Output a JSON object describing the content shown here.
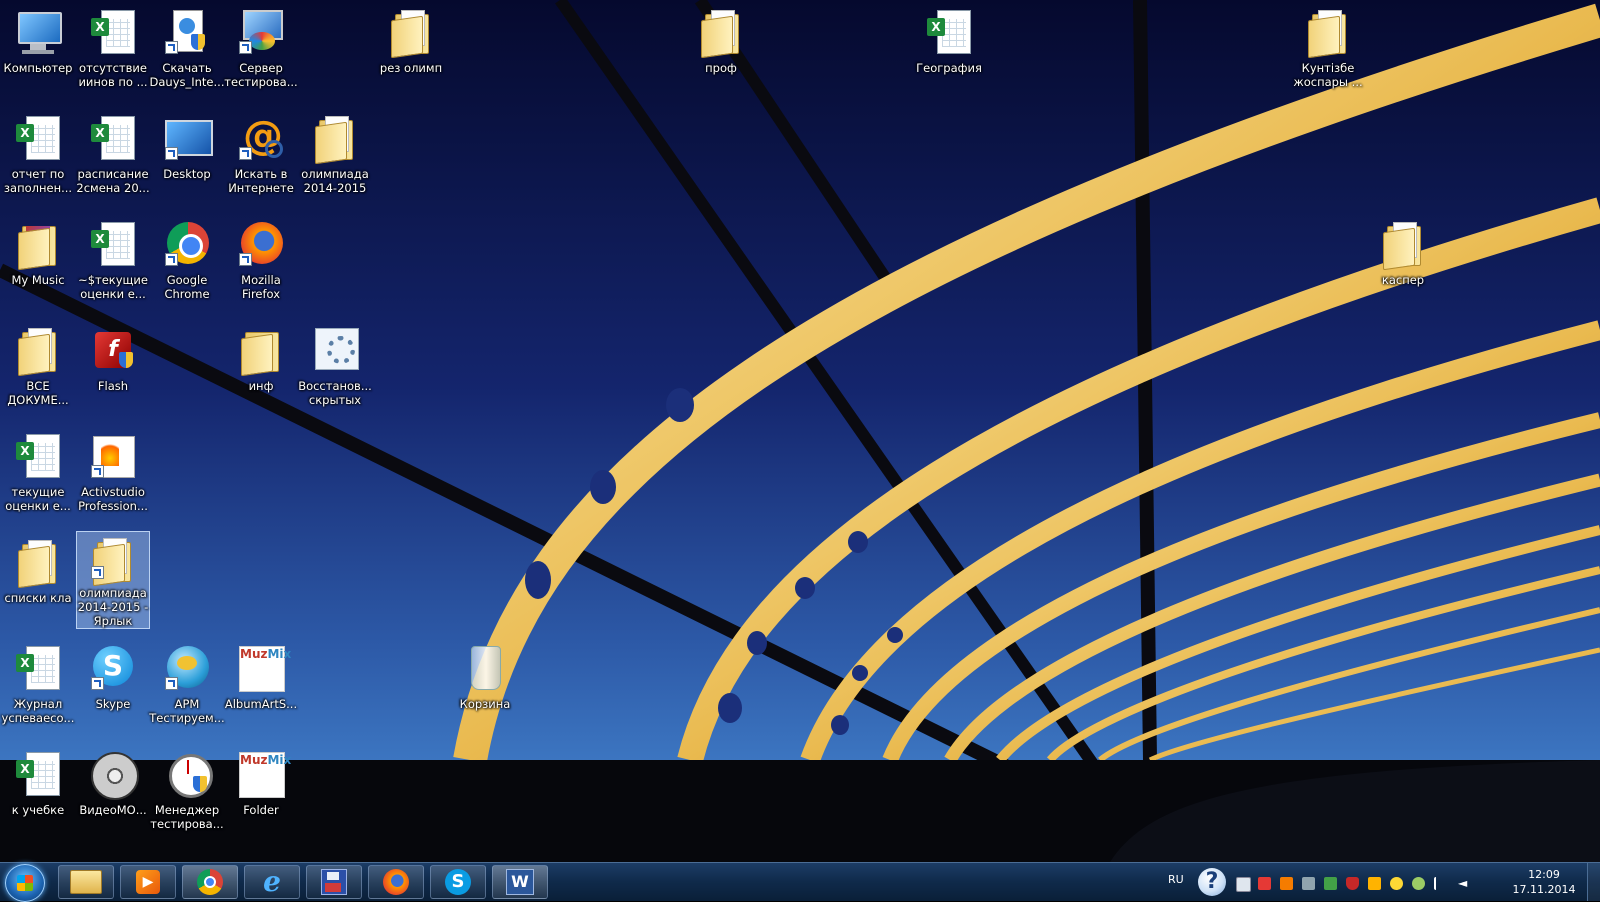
{
  "desktop": {
    "icons": [
      {
        "label": "Компьютер"
      },
      {
        "label": "отсутствие\nиинов по ..."
      },
      {
        "label": "Скачать\nDauys_Inte..."
      },
      {
        "label": "Сервер\nтестирова..."
      },
      {
        "label": "рез олимп"
      },
      {
        "label": "проф"
      },
      {
        "label": "География"
      },
      {
        "label": "Кунтізбе\nжоспары ..."
      },
      {
        "label": "отчет по\nзаполнен..."
      },
      {
        "label": "расписание\n2смена 20..."
      },
      {
        "label": "Desktop"
      },
      {
        "label": "Искать в\nИнтернете"
      },
      {
        "label": "олимпиада\n2014-2015"
      },
      {
        "label": "My Music"
      },
      {
        "label": "~$текущие\nоценки е..."
      },
      {
        "label": "Google\nChrome"
      },
      {
        "label": "Mozilla\nFirefox"
      },
      {
        "label": "каспер"
      },
      {
        "label": "ВСЕ\nДОКУМЕ..."
      },
      {
        "label": "Flash"
      },
      {
        "label": "инф"
      },
      {
        "label": "Восстанов...\nскрытых"
      },
      {
        "label": "текущие\nоценки е..."
      },
      {
        "label": "Activstudio\nProfession..."
      },
      {
        "label": "списки кла"
      },
      {
        "label": "олимпиада\n2014-2015 -\nЯрлык"
      },
      {
        "label": "Журнал\nуспеваесо..."
      },
      {
        "label": "Skype"
      },
      {
        "label": "АРМ\nТестируем..."
      },
      {
        "label": "AlbumArtS..."
      },
      {
        "label": "Корзина"
      },
      {
        "label": "к учебке"
      },
      {
        "label": "ВидеоМО..."
      },
      {
        "label": "Менеджер\nтестирова..."
      },
      {
        "label": "Folder"
      }
    ]
  },
  "taskbar": {
    "language": "RU",
    "help_glyph": "?",
    "clock_time": "12:09",
    "clock_date": "17.11.2014"
  },
  "colors": {
    "excel_green": "#1e8a3c",
    "taskbar_bg": "#0f2a4a",
    "sky_top": "#0a1040",
    "sky_bottom": "#3a78c0"
  }
}
